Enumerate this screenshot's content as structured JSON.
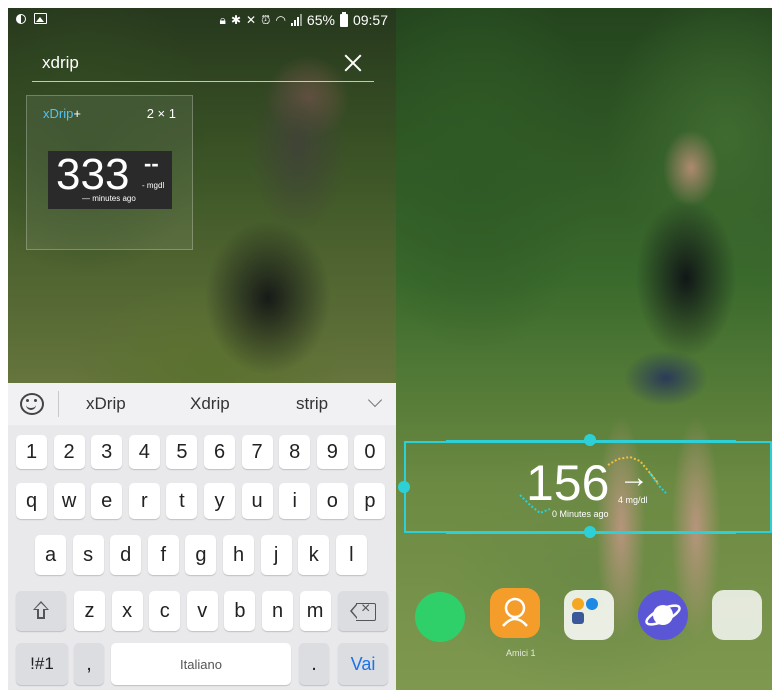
{
  "left_phone": {
    "status_bar": {
      "battery": "65%",
      "time": "09:57"
    },
    "search": {
      "query": "xdrip"
    },
    "widget_card": {
      "app_name_prefix": "xDrip",
      "app_name_suffix": "+",
      "size": "2 × 1",
      "preview": {
        "value": "333",
        "trend": "--",
        "unit": "- mgdl",
        "time": "— minutes ago"
      }
    },
    "keyboard": {
      "suggestions": [
        "xDrip",
        "Xdrip",
        "strip"
      ],
      "number_row": [
        "1",
        "2",
        "3",
        "4",
        "5",
        "6",
        "7",
        "8",
        "9",
        "0"
      ],
      "row1": [
        "q",
        "w",
        "e",
        "r",
        "t",
        "y",
        "u",
        "i",
        "o",
        "p"
      ],
      "row2": [
        "a",
        "s",
        "d",
        "f",
        "g",
        "h",
        "j",
        "k",
        "l"
      ],
      "row3": [
        "z",
        "x",
        "c",
        "v",
        "b",
        "n",
        "m"
      ],
      "symbols_key": "!#1",
      "comma_key": ",",
      "space_label": "Italiano",
      "period_key": ".",
      "action_key": "Vai"
    }
  },
  "right_phone": {
    "xdrip_widget": {
      "value": "156",
      "trend": "→",
      "unit": "4 mg/dl",
      "time": "0 Minutes ago"
    },
    "dock_label": "Amici 1"
  },
  "colors": {
    "accent_cyan": "#2ed0d8",
    "xdrip_blue": "#4fc3f7",
    "go_key": "#1a73e8"
  }
}
